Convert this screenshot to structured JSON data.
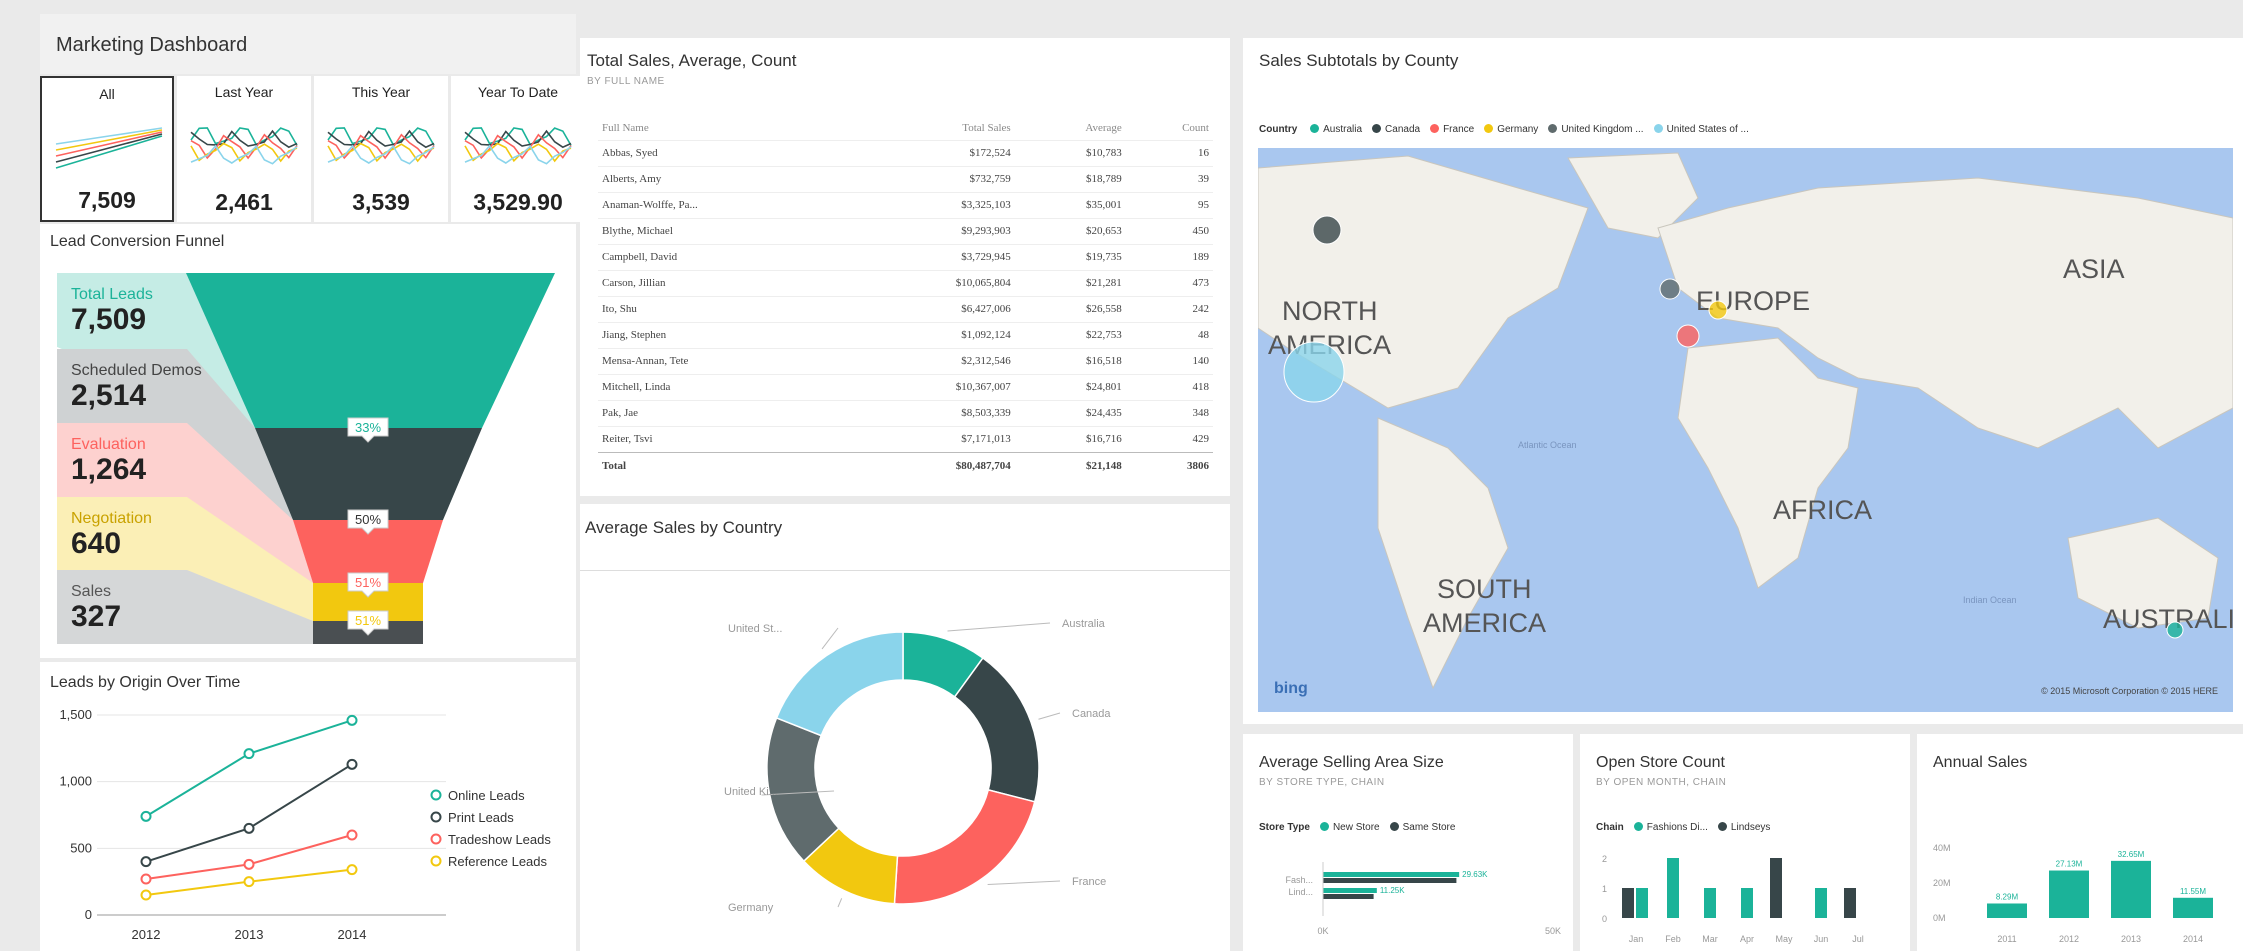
{
  "dashboard": {
    "title": "Marketing Dashboard"
  },
  "kpi_tiles": [
    {
      "label": "All",
      "value": "7,509"
    },
    {
      "label": "Last Year",
      "value": "2,461"
    },
    {
      "label": "This Year",
      "value": "3,539"
    },
    {
      "label": "Year To Date",
      "value": "3,529.90"
    }
  ],
  "funnel": {
    "title": "Lead Conversion Funnel",
    "stages": [
      {
        "label": "Total Leads",
        "value": "7,509",
        "color": "#1bb399"
      },
      {
        "label": "Scheduled Demos",
        "value": "2,514",
        "color": "#374649"
      },
      {
        "label": "Evaluation",
        "value": "1,264",
        "color": "#fd625e"
      },
      {
        "label": "Negotiation",
        "value": "640",
        "color": "#f2c80f"
      },
      {
        "label": "Sales",
        "value": "327",
        "color": "#4a4f52"
      }
    ],
    "conversion_badges": [
      "33%",
      "50%",
      "51%",
      "51%"
    ]
  },
  "leads_chart": {
    "title": "Leads by Origin Over Time",
    "chart_data": {
      "type": "line",
      "x": [
        "2012",
        "2013",
        "2014"
      ],
      "ylim": [
        0,
        1500
      ],
      "yticks": [
        "1,500",
        "1,000",
        "500",
        "0"
      ],
      "series": [
        {
          "name": "Online Leads",
          "values": [
            740,
            1210,
            1460
          ],
          "color": "#1bb399"
        },
        {
          "name": "Print Leads",
          "values": [
            400,
            650,
            1130
          ],
          "color": "#374649"
        },
        {
          "name": "Tradeshow Leads",
          "values": [
            270,
            380,
            600
          ],
          "color": "#fd625e"
        },
        {
          "name": "Reference Leads",
          "values": [
            150,
            250,
            340
          ],
          "color": "#f2c80f"
        }
      ],
      "legend_position": "right"
    }
  },
  "sales_table": {
    "title": "Total Sales, Average, Count",
    "subtitle": "BY FULL NAME",
    "columns": [
      "Full Name",
      "Total Sales",
      "Average",
      "Count"
    ],
    "rows": [
      [
        "Abbas, Syed",
        "$172,524",
        "$10,783",
        "16"
      ],
      [
        "Alberts, Amy",
        "$732,759",
        "$18,789",
        "39"
      ],
      [
        "Anaman-Wolffe, Pa...",
        "$3,325,103",
        "$35,001",
        "95"
      ],
      [
        "Blythe, Michael",
        "$9,293,903",
        "$20,653",
        "450"
      ],
      [
        "Campbell, David",
        "$3,729,945",
        "$19,735",
        "189"
      ],
      [
        "Carson, Jillian",
        "$10,065,804",
        "$21,281",
        "473"
      ],
      [
        "Ito, Shu",
        "$6,427,006",
        "$26,558",
        "242"
      ],
      [
        "Jiang, Stephen",
        "$1,092,124",
        "$22,753",
        "48"
      ],
      [
        "Mensa-Annan, Tete",
        "$2,312,546",
        "$16,518",
        "140"
      ],
      [
        "Mitchell, Linda",
        "$10,367,007",
        "$24,801",
        "418"
      ],
      [
        "Pak, Jae",
        "$8,503,339",
        "$24,435",
        "348"
      ],
      [
        "Reiter, Tsvi",
        "$7,171,013",
        "$16,716",
        "429"
      ]
    ],
    "total": [
      "Total",
      "$80,487,704",
      "$21,148",
      "3806"
    ]
  },
  "donut": {
    "title": "Average Sales by Country",
    "chart_data": {
      "type": "pie",
      "categories": [
        "Australia",
        "Canada",
        "France",
        "Germany",
        "United Ki...",
        "United St..."
      ],
      "values": [
        10,
        19,
        22,
        12,
        18,
        19
      ],
      "colors": [
        "#1bb399",
        "#374649",
        "#fd625e",
        "#f2c80f",
        "#5f6b6d",
        "#8ad4eb"
      ]
    }
  },
  "map": {
    "title": "Sales Subtotals by County",
    "legend_title": "Country",
    "legend": [
      {
        "name": "Australia",
        "color": "#1bb399"
      },
      {
        "name": "Canada",
        "color": "#374649"
      },
      {
        "name": "France",
        "color": "#fd625e"
      },
      {
        "name": "Germany",
        "color": "#f2c80f"
      },
      {
        "name": "United Kingdom ...",
        "color": "#5f6b6d"
      },
      {
        "name": "United States of ...",
        "color": "#8ad4eb"
      }
    ],
    "labels": [
      "NORTH AMERICA",
      "EUROPE",
      "ASIA",
      "AFRICA",
      "SOUTH AMERICA",
      "AUSTRALI"
    ],
    "ocean_labels": [
      "Atlantic Ocean",
      "Indian Ocean"
    ],
    "logo": "bing",
    "copyright": "© 2015 Microsoft Corporation  © 2015 HERE",
    "colors": {
      "water": "#a9c7ef",
      "land": "#f2f0ea"
    }
  },
  "area_size": {
    "title": "Average Selling Area Size",
    "subtitle": "BY STORE TYPE, CHAIN",
    "legend_title": "Store Type",
    "chart_data": {
      "type": "bar",
      "categories": [
        "Fash...",
        "Lind..."
      ],
      "series": [
        {
          "name": "New Store",
          "values": [
            29.6,
            11.7
          ],
          "color": "#1bb399"
        },
        {
          "name": "Same Store",
          "values": [
            29.0,
            11.0
          ],
          "color": "#374649"
        }
      ],
      "data_labels": [
        "29.63K",
        "11.25K"
      ],
      "xticks": [
        "0K",
        "50K"
      ]
    }
  },
  "store_count": {
    "title": "Open Store Count",
    "subtitle": "BY OPEN MONTH, CHAIN",
    "legend_title": "Chain",
    "chart_data": {
      "type": "bar",
      "categories": [
        "Jan",
        "Feb",
        "Mar",
        "Apr",
        "May",
        "Jun",
        "Jul"
      ],
      "yticks": [
        "2",
        "1",
        "0"
      ],
      "series": [
        {
          "name": "Fashions Di...",
          "values": [
            1,
            2,
            1,
            1,
            0,
            1,
            0
          ],
          "color": "#1bb399"
        },
        {
          "name": "Lindseys",
          "values": [
            1,
            0,
            0,
            0,
            2,
            0,
            1
          ],
          "color": "#374649"
        }
      ]
    }
  },
  "annual_sales": {
    "title": "Annual Sales",
    "chart_data": {
      "type": "bar",
      "categories": [
        "2011",
        "2012",
        "2013",
        "2014"
      ],
      "values": [
        8.29,
        27.13,
        32.65,
        11.55
      ],
      "data_labels": [
        "8.29M",
        "27.13M",
        "32.65M",
        "11.55M"
      ],
      "yticks": [
        "40M",
        "20M",
        "0M"
      ],
      "color": "#1bb399"
    }
  }
}
